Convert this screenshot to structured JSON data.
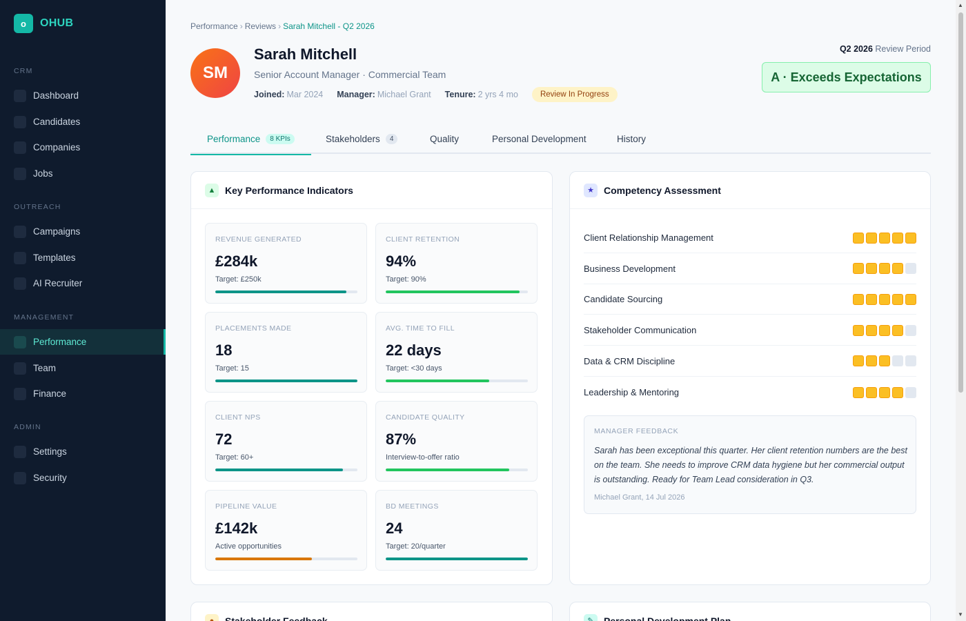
{
  "brand": {
    "logo": "o",
    "name": "OHUB"
  },
  "sidebar": {
    "sections": [
      {
        "title": "CRM",
        "items": [
          {
            "label": "Dashboard"
          },
          {
            "label": "Candidates"
          },
          {
            "label": "Companies"
          },
          {
            "label": "Jobs"
          }
        ]
      },
      {
        "title": "OUTREACH",
        "items": [
          {
            "label": "Campaigns"
          },
          {
            "label": "Templates"
          },
          {
            "label": "AI Recruiter"
          }
        ]
      },
      {
        "title": "MANAGEMENT",
        "items": [
          {
            "label": "Performance",
            "active": true
          },
          {
            "label": "Team"
          },
          {
            "label": "Finance"
          }
        ]
      },
      {
        "title": "ADMIN",
        "items": [
          {
            "label": "Settings"
          },
          {
            "label": "Security"
          }
        ]
      }
    ]
  },
  "breadcrumb": {
    "items": [
      "Performance",
      "Reviews"
    ],
    "separator": "›",
    "current": "Sarah Mitchell - Q2 2026"
  },
  "profile": {
    "initials": "SM",
    "name": "Sarah Mitchell",
    "role": "Senior Account Manager · Commercial Team",
    "joined_label": "Joined:",
    "joined": "Mar 2024",
    "manager_label": "Manager:",
    "manager": "Michael Grant",
    "tenure_label": "Tenure:",
    "tenure": "2 yrs 4 mo",
    "status": "Review In Progress"
  },
  "period": {
    "value": "Q2 2026",
    "label": "Review Period"
  },
  "rating": "A · Exceeds Expectations",
  "tabs": [
    {
      "label": "Performance",
      "badge": "8 KPIs",
      "active": true
    },
    {
      "label": "Stakeholders",
      "badge": "4"
    },
    {
      "label": "Quality"
    },
    {
      "label": "Personal Development"
    },
    {
      "label": "History"
    }
  ],
  "kpi_card": {
    "title": "Key Performance Indicators",
    "icon": "triangle-up-icon",
    "items": [
      {
        "label": "REVENUE GENERATED",
        "value": "£284k",
        "sub": "Target: £250k",
        "progress": 0.92,
        "color": "#0d9488"
      },
      {
        "label": "CLIENT RETENTION",
        "value": "94%",
        "sub": "Target: 90%",
        "progress": 0.94,
        "color": "#22c55e"
      },
      {
        "label": "PLACEMENTS MADE",
        "value": "18",
        "sub": "Target: 15",
        "progress": 1.0,
        "color": "#0d9488"
      },
      {
        "label": "AVG. TIME TO FILL",
        "value": "22 days",
        "sub": "Target: <30 days",
        "progress": 0.73,
        "color": "#22c55e"
      },
      {
        "label": "CLIENT NPS",
        "value": "72",
        "sub": "Target: 60+",
        "progress": 0.9,
        "color": "#0d9488"
      },
      {
        "label": "CANDIDATE QUALITY",
        "value": "87%",
        "sub": "Interview-to-offer ratio",
        "progress": 0.87,
        "color": "#22c55e"
      },
      {
        "label": "PIPELINE VALUE",
        "value": "£142k",
        "sub": "Active opportunities",
        "progress": 0.68,
        "color": "#d97706"
      },
      {
        "label": "BD MEETINGS",
        "value": "24",
        "sub": "Target: 20/quarter",
        "progress": 1.0,
        "color": "#0d9488"
      }
    ]
  },
  "competency_card": {
    "title": "Competency Assessment",
    "icon": "star-icon",
    "max_score": 5,
    "items": [
      {
        "label": "Client Relationship Management",
        "score": 5
      },
      {
        "label": "Business Development",
        "score": 4
      },
      {
        "label": "Candidate Sourcing",
        "score": 5
      },
      {
        "label": "Stakeholder Communication",
        "score": 4
      },
      {
        "label": "Data & CRM Discipline",
        "score": 3
      },
      {
        "label": "Leadership & Mentoring",
        "score": 4
      }
    ],
    "feedback": {
      "title": "MANAGER FEEDBACK",
      "text": "Sarah has been exceptional this quarter. Her client retention numbers are the best on the team. She needs to improve CRM data hygiene but her commercial output is outstanding. Ready for Team Lead consideration in Q3.",
      "author": "Michael Grant, 14 Jul 2026"
    }
  },
  "bottom_cards": {
    "left": "Stakeholder Feedback",
    "right": "Personal Development Plan"
  },
  "colors": {
    "accent": "#14b8a6",
    "sidebar": "#0f1b2d",
    "rating_bg": "#dcfce7",
    "star": "#fbbf24"
  }
}
